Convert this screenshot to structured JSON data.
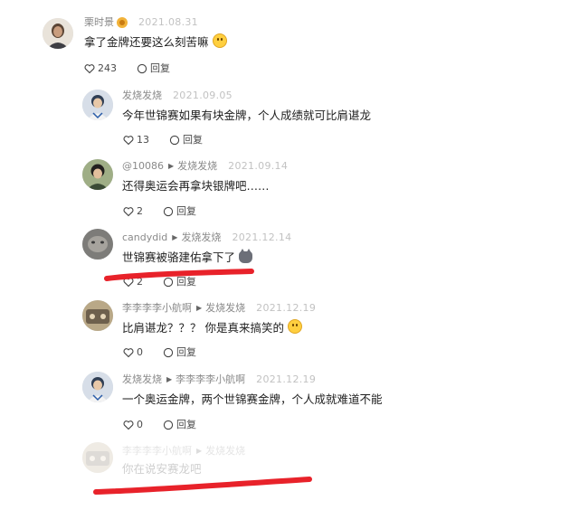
{
  "colors": {
    "date": "#c2c2c2",
    "annotation": "#e8222a",
    "text": "#1f1f1f"
  },
  "comments": [
    {
      "user": "栗时景",
      "date": "2021.08.31",
      "text": "拿了金牌还要这么刻苦嘛",
      "likes": "243",
      "reply_label": "回复"
    },
    {
      "user": "发烧发烧",
      "date": "2021.09.05",
      "text": "今年世锦赛如果有块金牌，个人成绩就可比肩谌龙",
      "likes": "13",
      "reply_label": "回复"
    },
    {
      "user": "@10086",
      "reply_to": "发烧发烧",
      "date": "2021.09.14",
      "text": "还得奥运会再拿块银牌吧……",
      "likes": "2",
      "reply_label": "回复"
    },
    {
      "user": "candydid",
      "reply_to": "发烧发烧",
      "date": "2021.12.14",
      "text": "世锦赛被骆建佑拿下了",
      "likes": "2",
      "reply_label": "回复"
    },
    {
      "user": "李李李李小航啊",
      "reply_to": "发烧发烧",
      "date": "2021.12.19",
      "text": "比肩谌龙？？？ 你是真来搞笑的",
      "likes": "0",
      "reply_label": "回复"
    },
    {
      "user": "发烧发烧",
      "reply_to": "李李李李小航啊",
      "date": "2021.12.19",
      "text": "一个奥运金牌，两个世锦赛金牌，个人成就难道不能",
      "likes": "0",
      "reply_label": "回复"
    },
    {
      "user": "李李李李小航啊",
      "reply_to": "发烧发烧",
      "text": "你在说安赛龙吧"
    }
  ]
}
